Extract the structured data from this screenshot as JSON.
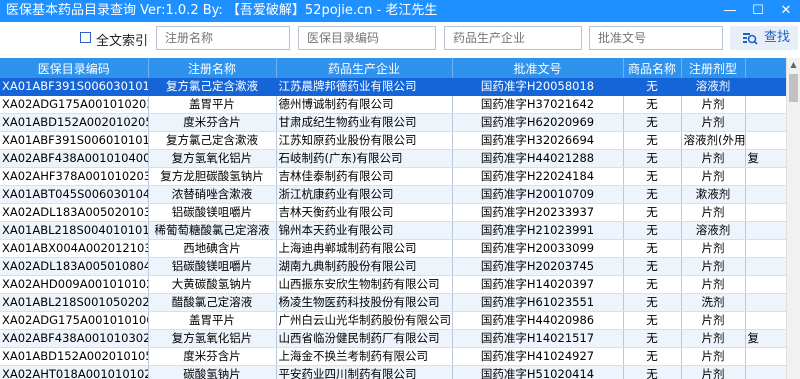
{
  "window": {
    "title": "医保基本药品目录查询 Ver:1.0.2 By: 【吾爱破解】52pojie.cn - 老江先生",
    "min": "—",
    "max": "☐",
    "close": "✕"
  },
  "toolbar": {
    "fulltext_label": "全文索引",
    "reg_name_placeholder": "注册名称",
    "code_placeholder": "医保目录编码",
    "company_placeholder": "药品生产企业",
    "approval_placeholder": "批准文号",
    "search_label": "查找",
    "search_icon": "search-icon"
  },
  "table": {
    "columns": [
      "医保目录编码",
      "注册名称",
      "药品生产企业",
      "批准文号",
      "商品名称",
      "注册剂型",
      ""
    ],
    "rows": [
      [
        "XA01ABF391S006030101427",
        "复方氯己定含漱液",
        "江苏晨牌邦德药业有限公司",
        "国药准字H20058018",
        "无",
        "溶液剂",
        ""
      ],
      [
        "XA02ADG175A001010203941",
        "盖胃平片",
        "德州博诚制药有限公司",
        "国药准字H37021642",
        "无",
        "片剂",
        ""
      ],
      [
        "XA01ABD152A002010205889",
        "度米芬含片",
        "甘肃成纪生物药业有限公司",
        "国药准字H62020969",
        "无",
        "片剂",
        ""
      ],
      [
        "XA01ABF391S006010101486",
        "复方氯己定含漱液",
        "江苏知原药业股份有限公司",
        "国药准字H32026694",
        "无",
        "溶液剂(外用)",
        ""
      ],
      [
        "XA02ABF438A001010400322",
        "复方氢氧化铝片",
        "石岐制药(广东)有限公司",
        "国药准字H44021288",
        "无",
        "片剂",
        "复"
      ],
      [
        "XA02AHF378A001010203422",
        "复方龙胆碳酸氢钠片",
        "吉林佳泰制药有限公司",
        "国药准字H22024184",
        "无",
        "片剂",
        ""
      ],
      [
        "XA01ABT045S006030104642",
        "浓替硝唑含漱液",
        "浙江杭康药业有限公司",
        "国药准字H20010709",
        "无",
        "漱液剂",
        ""
      ],
      [
        "XA02ADL183A005020103006",
        "铝碳酸镁咀嚼片",
        "吉林天衡药业有限公司",
        "国药准字H20233937",
        "无",
        "片剂",
        ""
      ],
      [
        "XA01ABL218S004010101191",
        "稀葡萄糖酸氯己定溶液",
        "锦州本天药业有限公司",
        "国药准字H21023991",
        "无",
        "溶液剂",
        ""
      ],
      [
        "XA01ABX004A002012103034",
        "西地碘含片",
        "上海迪冉郸城制药有限公司",
        "国药准字H20033099",
        "无",
        "片剂",
        ""
      ],
      [
        "XA02ADL183A005010804942",
        "铝碳酸镁咀嚼片",
        "湖南九典制药股份有限公司",
        "国药准字H20203745",
        "无",
        "片剂",
        ""
      ],
      [
        "XA02AHD009A001010102967",
        "大黄碳酸氢钠片",
        "山西振东安欣生物制药有限公司",
        "国药准字H14020397",
        "无",
        "片剂",
        ""
      ],
      [
        "XA01ABL218S001050202396",
        "醋酸氯己定溶液",
        "杨凌生物医药科技股份有限公司",
        "国药准字H61023551",
        "无",
        "洗剂",
        ""
      ],
      [
        "XA02ADG175A001010100372",
        "盖胃平片",
        "广州白云山光华制药股份有限公司",
        "国药准字H44020986",
        "无",
        "片剂",
        ""
      ],
      [
        "XA02ABF438A001010302933",
        "复方氢氧化铝片",
        "山西省临汾健民制药厂有限公司",
        "国药准字H14021517",
        "无",
        "片剂",
        "复"
      ],
      [
        "XA01ABD152A002010105059",
        "度米芬含片",
        "上海金不换兰考制药有限公司",
        "国药准字H41024927",
        "无",
        "片剂",
        ""
      ],
      [
        "XA02AHT018A001010102381",
        "碳酸氢钠片",
        "平安药业四川制药有限公司",
        "国药准字H51020414",
        "无",
        "片剂",
        ""
      ]
    ]
  },
  "colors": {
    "titlebar": "#1e90ff",
    "header": "#2f93ee",
    "selected_row": "#1565d8",
    "alt_row": "#eef4fb"
  }
}
